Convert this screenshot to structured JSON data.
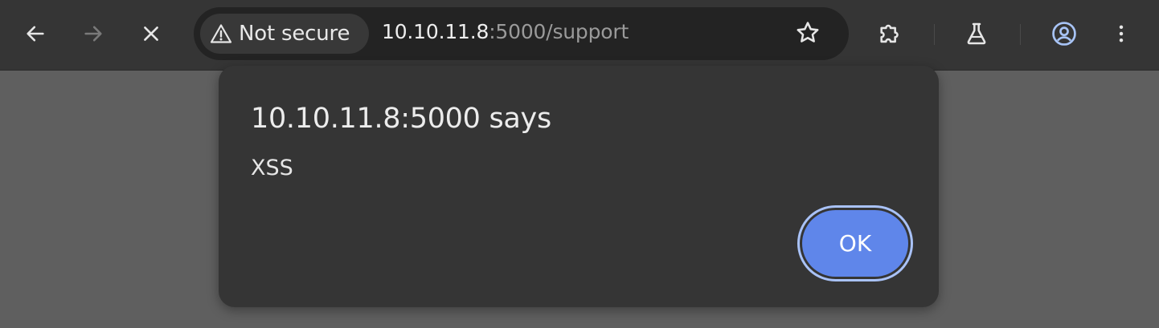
{
  "toolbar": {
    "security": {
      "label": "Not secure",
      "icon": "warning-triangle-icon"
    },
    "url": {
      "host": "10.10.11.8",
      "rest": ":5000/support"
    },
    "icons": {
      "back": "arrow-left-icon",
      "forward": "arrow-right-icon",
      "stop": "close-icon",
      "bookmark": "star-icon",
      "extensions": "puzzle-icon",
      "labs": "flask-icon",
      "profile": "account-circle-icon",
      "menu": "kebab-menu-icon"
    }
  },
  "dialog": {
    "title": "10.10.11.8:5000 says",
    "message": "XSS",
    "ok_label": "OK"
  },
  "colors": {
    "toolbar_bg": "#353535",
    "omnibox_bg": "#232323",
    "page_overlay": "#5f5f5f",
    "dialog_bg": "#353535",
    "ok_button": "#5f86ea",
    "ok_focus_ring": "#a9c2f7",
    "profile_accent": "#a8c4f6"
  }
}
